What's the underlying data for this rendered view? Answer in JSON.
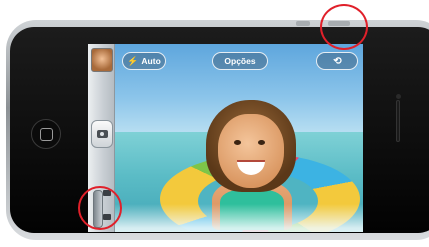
{
  "camera_ui": {
    "flash_label": "Auto",
    "flash_icon": "⚡",
    "options_label": "Opções",
    "switch_camera_icon": "⟲"
  },
  "colors": {
    "highlight": "#e0202a",
    "phone_body": "#111111"
  }
}
